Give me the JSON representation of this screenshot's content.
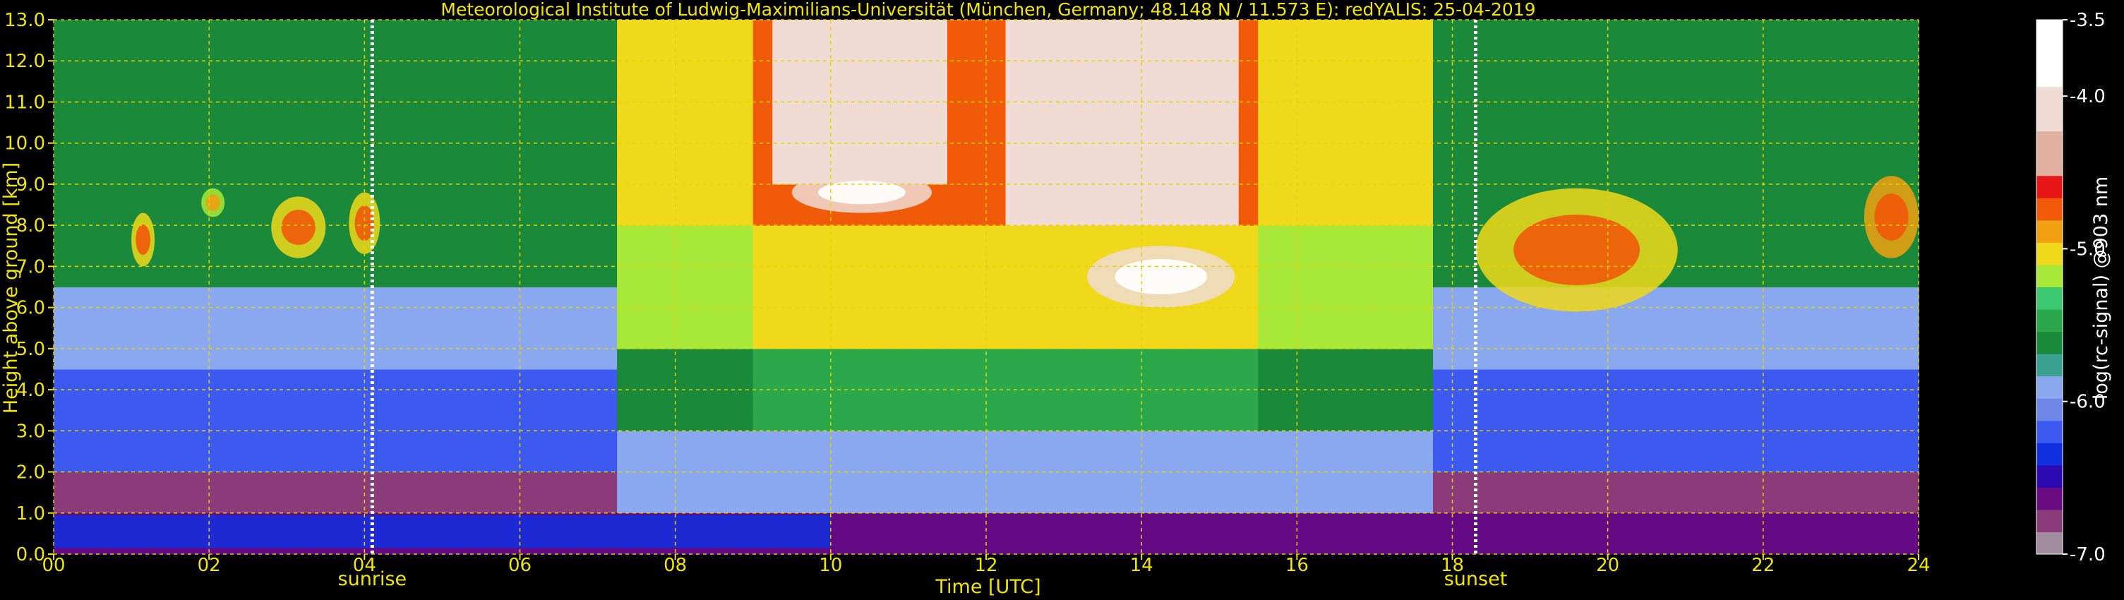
{
  "chart_data": {
    "type": "heatmap",
    "title": "Meteorological Institute of Ludwig-Maximilians-Universität (München, Germany; 48.148 N / 11.573 E):    redYALIS: 25-04-2019",
    "xlabel": "Time [UTC]",
    "ylabel": "Height above ground [km]",
    "colorbar_label": "log(rc-signal) @903 nm",
    "xlim": [
      0,
      24
    ],
    "ylim": [
      0,
      13
    ],
    "x_ticks": [
      0,
      2,
      4,
      6,
      8,
      10,
      12,
      14,
      16,
      18,
      20,
      22,
      24
    ],
    "x_tick_labels": [
      "00",
      "02",
      "04",
      "06",
      "08",
      "10",
      "12",
      "14",
      "16",
      "18",
      "20",
      "22",
      "24"
    ],
    "y_ticks": [
      0,
      1,
      2,
      3,
      4,
      5,
      6,
      7,
      8,
      9,
      10,
      11,
      12,
      13
    ],
    "y_tick_labels": [
      "0.0",
      "1.0",
      "2.0",
      "3.0",
      "4.0",
      "5.0",
      "6.0",
      "7.0",
      "8.0",
      "9.0",
      "10.0",
      "11.0",
      "12.0",
      "13.0"
    ],
    "grid": true,
    "colorbar": {
      "range": [
        -7.0,
        -3.5
      ],
      "ticks": [
        -3.5,
        -4.0,
        -5.0,
        -6.0,
        -7.0
      ],
      "tick_labels": [
        "-3.5",
        "-4.0",
        "-5.0",
        "-6.0",
        "-7.0"
      ]
    },
    "events": [
      {
        "label": "sunrise",
        "time": 4.1
      },
      {
        "label": "sunset",
        "time": 18.3
      }
    ],
    "features": [
      {
        "kind": "boundary-layer",
        "t_start": 0,
        "t_end": 24,
        "h_bottom": 0.0,
        "h_top": 1.0,
        "value": -6.6
      },
      {
        "kind": "cloud",
        "t_start": 1.0,
        "t_end": 1.3,
        "h_bottom": 7.0,
        "h_top": 8.3,
        "value": -5.0
      },
      {
        "kind": "cloud",
        "t_start": 1.9,
        "t_end": 2.2,
        "h_bottom": 8.2,
        "h_top": 8.9,
        "value": -5.1
      },
      {
        "kind": "cloud",
        "t_start": 2.8,
        "t_end": 3.5,
        "h_bottom": 7.2,
        "h_top": 8.7,
        "value": -5.0
      },
      {
        "kind": "cloud",
        "t_start": 3.8,
        "t_end": 4.2,
        "h_bottom": 7.3,
        "h_top": 8.8,
        "value": -5.0
      },
      {
        "kind": "cloud",
        "t_start": 13.3,
        "t_end": 15.2,
        "h_bottom": 6.0,
        "h_top": 7.5,
        "value": -4.1
      },
      {
        "kind": "cloud",
        "t_start": 9.5,
        "t_end": 11.3,
        "h_bottom": 8.3,
        "h_top": 9.3,
        "value": -4.3
      },
      {
        "kind": "cloud",
        "t_start": 18.3,
        "t_end": 20.9,
        "h_bottom": 5.9,
        "h_top": 8.9,
        "value": -5.0
      },
      {
        "kind": "cloud",
        "t_start": 23.3,
        "t_end": 24.0,
        "h_bottom": 7.2,
        "h_top": 9.2,
        "value": -4.9
      }
    ]
  }
}
